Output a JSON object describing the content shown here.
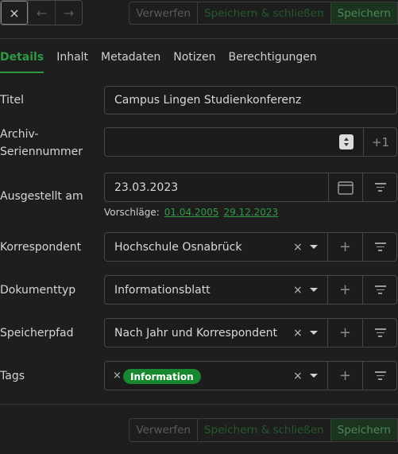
{
  "toolbar": {
    "close_glyph": "×",
    "back_glyph": "←",
    "forward_glyph": "→",
    "discard_label": "Verwerfen",
    "save_close_label": "Speichern & schließen",
    "save_label": "Speichern"
  },
  "tabs": [
    {
      "label": "Details",
      "active": true
    },
    {
      "label": "Inhalt"
    },
    {
      "label": "Metadaten"
    },
    {
      "label": "Notizen"
    },
    {
      "label": "Berechtigungen"
    }
  ],
  "form": {
    "title": {
      "label": "Titel",
      "value": "Campus Lingen Studienkonferenz"
    },
    "asn": {
      "label_line1": "Archiv-",
      "label_line2": "Seriennummer",
      "value": "",
      "plus_one": "+1"
    },
    "created": {
      "label": "Ausgestellt am",
      "value": "23.03.2023",
      "suggestions_label": "Vorschläge:",
      "suggestions": [
        "01.04.2005",
        "29.12.2023"
      ]
    },
    "correspondent": {
      "label": "Korrespondent",
      "value": "Hochschule Osnabrück"
    },
    "document_type": {
      "label": "Dokumenttyp",
      "value": "Informationsblatt"
    },
    "storage_path": {
      "label": "Speicherpfad",
      "value": "Nach Jahr und Korrespondent"
    },
    "tags": {
      "label": "Tags",
      "items": [
        {
          "name": "Information",
          "color": "#17882f"
        }
      ]
    }
  },
  "icons": {
    "clear": "×",
    "add": "+",
    "calendar": "calendar-icon",
    "filter": "filter-icon",
    "dropdown": "chevron-down-icon"
  },
  "colors": {
    "accent": "#2f9a45",
    "background": "#1e1e1e",
    "tag": "#17882f"
  }
}
